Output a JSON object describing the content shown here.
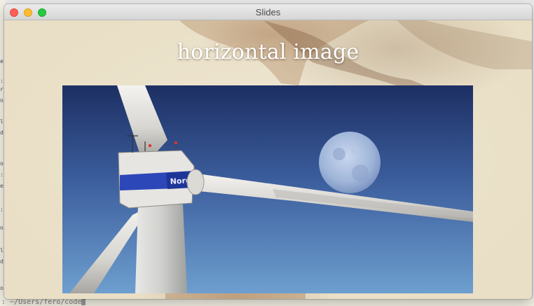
{
  "window": {
    "title": "Slides"
  },
  "slide": {
    "heading": "horizontal image",
    "image": {
      "subject": "wind turbine with moon",
      "nacelle_brand_text": "Nordex"
    }
  },
  "background_terminal": {
    "path_text": ": ~/Users/fero/code"
  },
  "colors": {
    "sky_top": "#1d2f63",
    "sky_bottom": "#6e9fcf",
    "close": "#fe5f57",
    "minimize": "#febc2e",
    "maximize": "#28c840"
  }
}
